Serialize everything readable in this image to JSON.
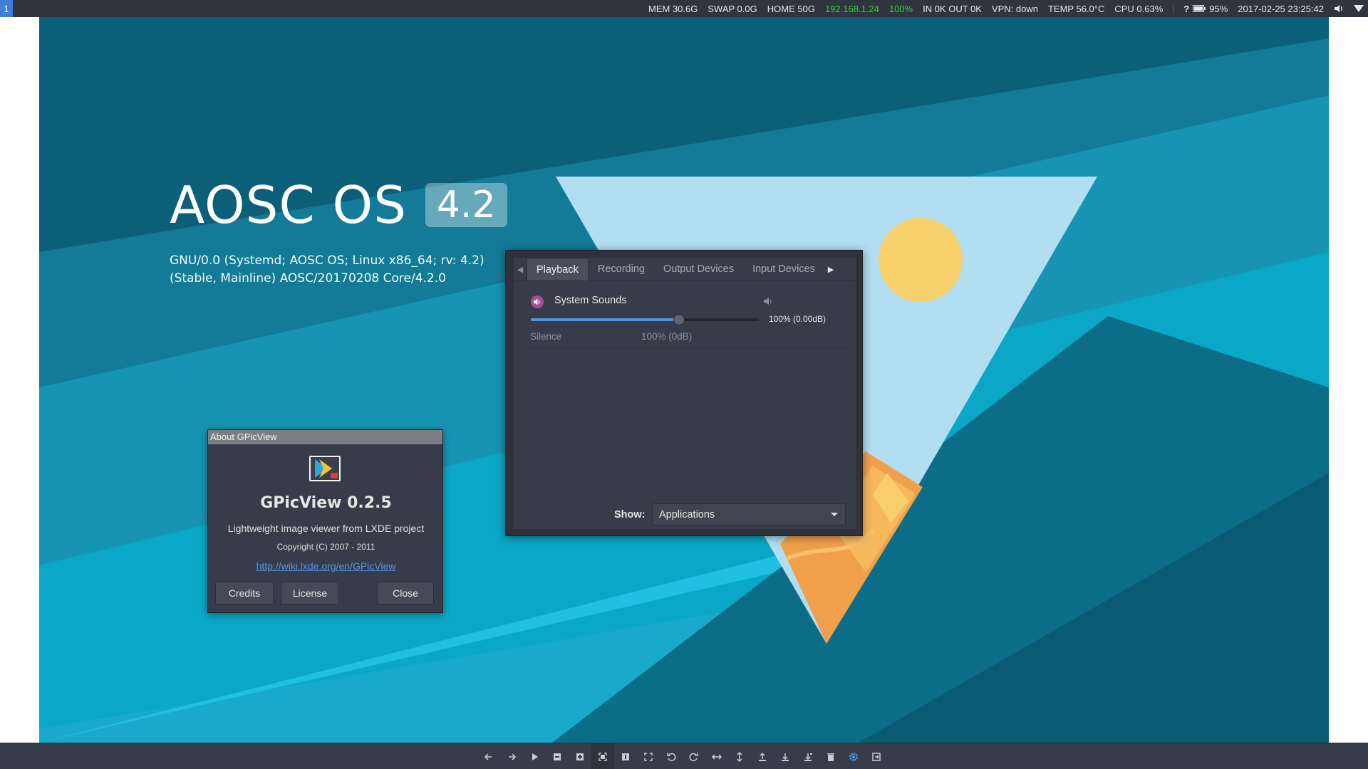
{
  "panel": {
    "workspace": "1",
    "mem": "MEM 30.6G",
    "swap": "SWAP 0.0G",
    "home": "HOME 50G",
    "ip": "192.168.1.24",
    "wifi": "100%",
    "net": "IN 0K OUT 0K",
    "vpn": "VPN: down",
    "temp": "TEMP 56.0°C",
    "cpu": "CPU 0.63%",
    "battery_status": "?",
    "battery": "95%",
    "datetime": "2017-02-25 23:25:42"
  },
  "wallpaper": {
    "os_name": "AOSC OS",
    "version": "4.2",
    "line1": "GNU/0.0 (Systemd; AOSC OS; Linux x86_64; rv: 4.2)",
    "line2": "(Stable, Mainline) AOSC/20170208 Core/4.2.0"
  },
  "about_dialog": {
    "title": "About GPicView",
    "app_name": "GPicView 0.2.5",
    "description": "Lightweight image viewer from LXDE project",
    "copyright": "Copyright (C) 2007 - 2011",
    "link": "http://wiki.lxde.org/en/GPicView",
    "buttons": {
      "credits": "Credits",
      "license": "License",
      "close": "Close"
    }
  },
  "volume_control": {
    "tabs": [
      "Playback",
      "Recording",
      "Output Devices",
      "Input Devices"
    ],
    "active_tab": "Playback",
    "stream": {
      "name": "System Sounds",
      "volume_fraction": 0.65,
      "volume_text": "100% (0.00dB)",
      "mark_low": "Silence",
      "mark_mid": "100% (0dB)"
    },
    "show_label": "Show:",
    "show_value": "Applications"
  },
  "toolbar": {
    "icons": [
      "prev-icon",
      "next-icon",
      "slideshow-icon",
      "zoom-out-icon",
      "zoom-in-icon",
      "fit-icon",
      "original-size-icon",
      "fullscreen-icon",
      "rotate-left-icon",
      "rotate-right-icon",
      "flip-horizontal-icon",
      "flip-vertical-icon",
      "open-icon",
      "save-icon",
      "save-as-icon",
      "delete-icon",
      "preferences-icon",
      "quit-icon"
    ],
    "active_icon": "fit-icon",
    "accent_color": "#5294e2"
  },
  "colors": {
    "panel_bg": "#2f343f",
    "dialog_bg": "#383c4a",
    "accent": "#5294e2",
    "ip_green": "#35d135"
  }
}
